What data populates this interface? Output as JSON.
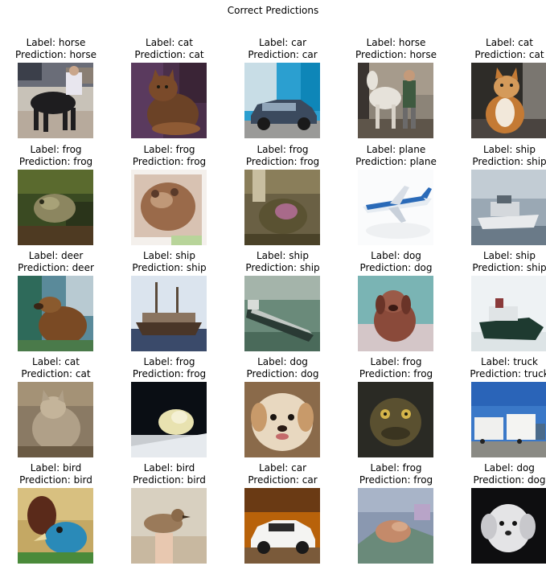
{
  "title": "Correct Predictions",
  "grid": [
    {
      "label": "Label: horse",
      "prediction": "Prediction: horse",
      "subject": "horse"
    },
    {
      "label": "Label: cat",
      "prediction": "Prediction: cat",
      "subject": "cat"
    },
    {
      "label": "Label: car",
      "prediction": "Prediction: car",
      "subject": "car"
    },
    {
      "label": "Label: horse",
      "prediction": "Prediction: horse",
      "subject": "horse"
    },
    {
      "label": "Label: cat",
      "prediction": "Prediction: cat",
      "subject": "cat"
    },
    {
      "label": "Label: frog",
      "prediction": "Prediction: frog",
      "subject": "frog"
    },
    {
      "label": "Label: frog",
      "prediction": "Prediction: frog",
      "subject": "frog"
    },
    {
      "label": "Label: frog",
      "prediction": "Prediction: frog",
      "subject": "frog"
    },
    {
      "label": "Label: plane",
      "prediction": "Prediction: plane",
      "subject": "plane"
    },
    {
      "label": "Label: ship",
      "prediction": "Prediction: ship",
      "subject": "ship"
    },
    {
      "label": "Label: deer",
      "prediction": "Prediction: deer",
      "subject": "deer"
    },
    {
      "label": "Label: ship",
      "prediction": "Prediction: ship",
      "subject": "ship"
    },
    {
      "label": "Label: ship",
      "prediction": "Prediction: ship",
      "subject": "ship"
    },
    {
      "label": "Label: dog",
      "prediction": "Prediction: dog",
      "subject": "dog"
    },
    {
      "label": "Label: ship",
      "prediction": "Prediction: ship",
      "subject": "ship"
    },
    {
      "label": "Label: cat",
      "prediction": "Prediction: cat",
      "subject": "cat"
    },
    {
      "label": "Label: frog",
      "prediction": "Prediction: frog",
      "subject": "frog"
    },
    {
      "label": "Label: dog",
      "prediction": "Prediction: dog",
      "subject": "dog"
    },
    {
      "label": "Label: frog",
      "prediction": "Prediction: frog",
      "subject": "frog"
    },
    {
      "label": "Label: truck",
      "prediction": "Prediction: truck",
      "subject": "truck"
    },
    {
      "label": "Label: bird",
      "prediction": "Prediction: bird",
      "subject": "bird"
    },
    {
      "label": "Label: bird",
      "prediction": "Prediction: bird",
      "subject": "bird"
    },
    {
      "label": "Label: car",
      "prediction": "Prediction: car",
      "subject": "car"
    },
    {
      "label": "Label: frog",
      "prediction": "Prediction: frog",
      "subject": "frog"
    },
    {
      "label": "Label: dog",
      "prediction": "Prediction: dog",
      "subject": "dog"
    }
  ]
}
